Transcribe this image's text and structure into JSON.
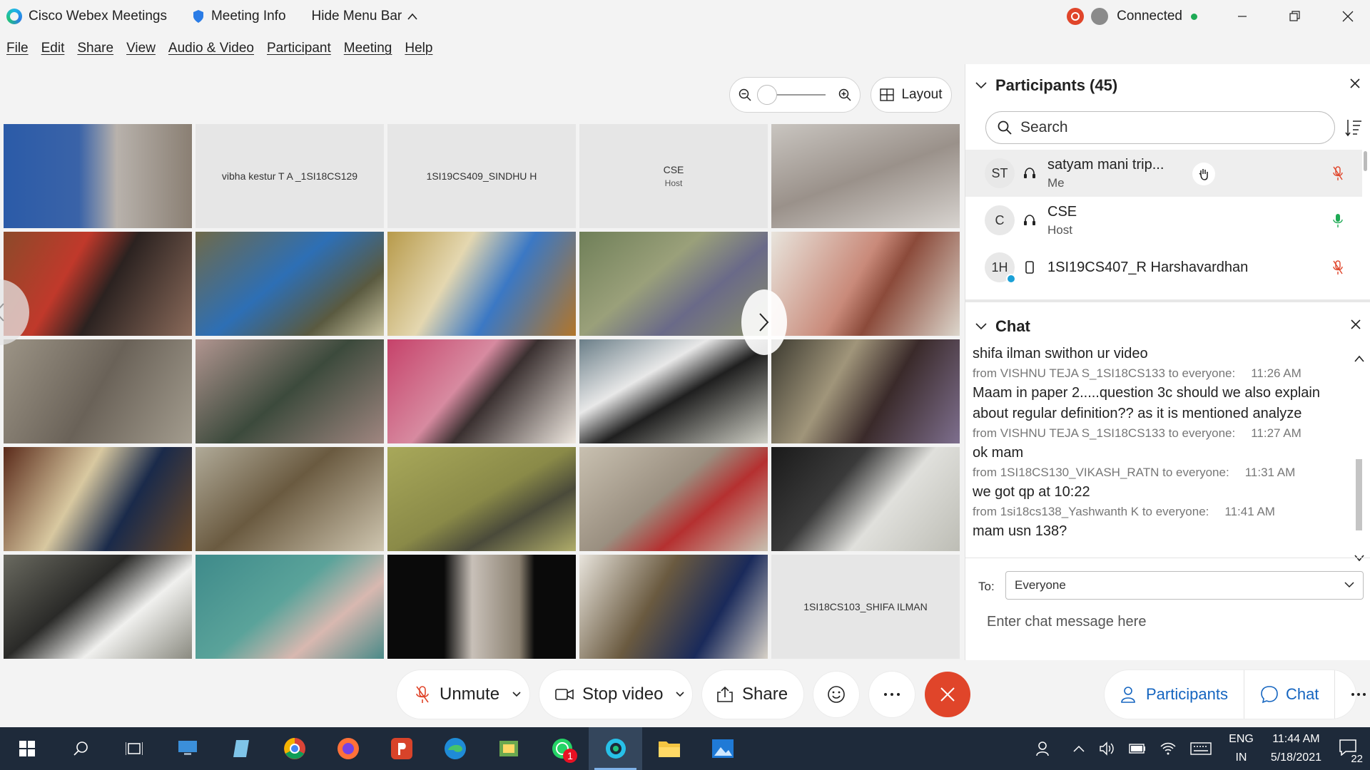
{
  "titlebar": {
    "app_name": "Cisco Webex Meetings",
    "meeting_info": "Meeting Info",
    "hide_menu": "Hide Menu Bar",
    "status": "Connected"
  },
  "menu": [
    "File",
    "Edit",
    "Share",
    "View",
    "Audio & Video",
    "Participant",
    "Meeting",
    "Help"
  ],
  "layout_button": "Layout",
  "video_tiles": {
    "vibha": "vibha kestur T A _1SI18CS129",
    "sindhu": "1SI19CS409_SINDHU H",
    "cse_name": "CSE",
    "cse_role": "Host",
    "shifa": "1SI18CS103_SHIFA ILMAN"
  },
  "controls": {
    "unmute": "Unmute",
    "stop_video": "Stop video",
    "share": "Share",
    "participants": "Participants",
    "chat": "Chat"
  },
  "participants_panel": {
    "title": "Participants (45)",
    "search_placeholder": "Search",
    "rows": [
      {
        "initials": "ST",
        "name": "satyam mani trip...",
        "role": "Me"
      },
      {
        "initials": "C",
        "name": "CSE",
        "role": "Host"
      },
      {
        "initials": "1H",
        "name": "1SI19CS407_R Harshavardhan",
        "role": ""
      }
    ]
  },
  "chat_panel": {
    "title": "Chat",
    "messages": [
      {
        "text": "shifa ilman swithon ur video"
      },
      {
        "from": "from VISHNU TEJA S_1SI18CS133 to everyone:",
        "time": "11:26 AM"
      },
      {
        "text": "Maam in paper 2.....question 3c should we also explain about regular definition?? as it is mentioned analyze"
      },
      {
        "from": "from VISHNU TEJA S_1SI18CS133 to everyone:",
        "time": "11:27 AM"
      },
      {
        "text": "ok mam"
      },
      {
        "from": "from 1SI18CS130_VIKASH_RATN to everyone:",
        "time": "11:31 AM"
      },
      {
        "text": "we got qp at 10:22"
      },
      {
        "from": "from 1si18cs138_Yashwanth K to everyone:",
        "time": "11:41 AM"
      },
      {
        "text": "mam usn 138?"
      }
    ],
    "to_label": "To:",
    "to_value": "Everyone",
    "input_placeholder": "Enter chat message here"
  },
  "taskbar": {
    "lang_top": "ENG",
    "lang_bottom": "IN",
    "time": "11:44 AM",
    "date": "5/18/2021",
    "notification_count": "22",
    "whatsapp_badge": "1"
  },
  "colors": {
    "accent_blue": "#1565c0",
    "leave_red": "#e0452a",
    "taskbar": "#1e2a3a"
  }
}
